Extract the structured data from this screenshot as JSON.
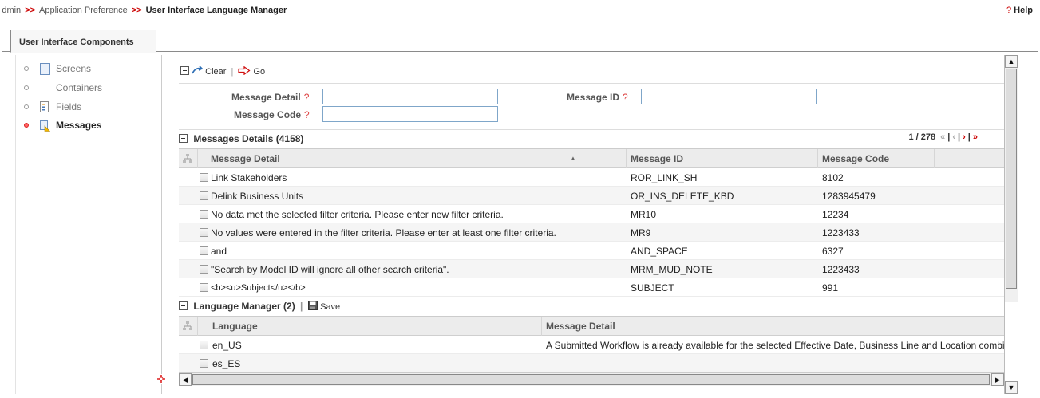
{
  "breadcrumb": {
    "items": [
      "Admin",
      "Application Preference",
      "User Interface Language Manager"
    ],
    "separator": ">>"
  },
  "help": {
    "icon": "?",
    "label": "Help"
  },
  "tabs": [
    {
      "label": "User Interface Components"
    }
  ],
  "sidebar": {
    "items": [
      {
        "label": "Screens",
        "icon": "screen-icon"
      },
      {
        "label": "Containers",
        "icon": ""
      },
      {
        "label": "Fields",
        "icon": "fields-icon"
      },
      {
        "label": "Messages",
        "icon": "messages-icon",
        "active": true
      }
    ]
  },
  "toolbar": {
    "clear_label": "Clear",
    "go_label": "Go"
  },
  "search": {
    "message_detail_label": "Message Detail",
    "message_id_label": "Message ID",
    "message_code_label": "Message Code",
    "help_mark": "?",
    "message_detail_value": "",
    "message_id_value": "",
    "message_code_value": ""
  },
  "messages": {
    "title": "Messages Details (4158)",
    "pager": {
      "page_text": "1 / 278"
    },
    "columns": [
      "Message Detail",
      "Message ID",
      "Message Code"
    ],
    "sort_indicator": "▲",
    "rows": [
      {
        "detail": "Link Stakeholders",
        "id": "ROR_LINK_SH",
        "code": "8102"
      },
      {
        "detail": "Delink Business Units",
        "id": "OR_INS_DELETE_KBD",
        "code": "1283945479"
      },
      {
        "detail": "No data met the selected filter criteria. Please enter new filter criteria.",
        "id": "MR10",
        "code": "12234"
      },
      {
        "detail": "No values were entered in the filter criteria. Please enter at least one filter criteria.",
        "id": "MR9",
        "code": "1223433"
      },
      {
        "detail": "and",
        "id": "AND_SPACE",
        "code": "6327"
      },
      {
        "detail": "\"Search by Model ID will ignore all other search criteria\".",
        "id": "MRM_MUD_NOTE",
        "code": "1223433"
      },
      {
        "detail": "<b><u>Subject</u></b>",
        "id": "SUBJECT",
        "code": "991"
      }
    ]
  },
  "language_manager": {
    "title": "Language Manager (2)",
    "save_label": "Save",
    "columns": [
      "Language",
      "Message Detail"
    ],
    "rows": [
      {
        "language": "en_US",
        "detail": "A Submitted Workflow is already available for the selected Effective Date, Business Line and Location combi..."
      },
      {
        "language": "es_ES",
        "detail": ""
      }
    ]
  },
  "colors": {
    "accent_red": "#cc0000",
    "input_border": "#7fa6c9",
    "header_bg": "#ececec"
  }
}
